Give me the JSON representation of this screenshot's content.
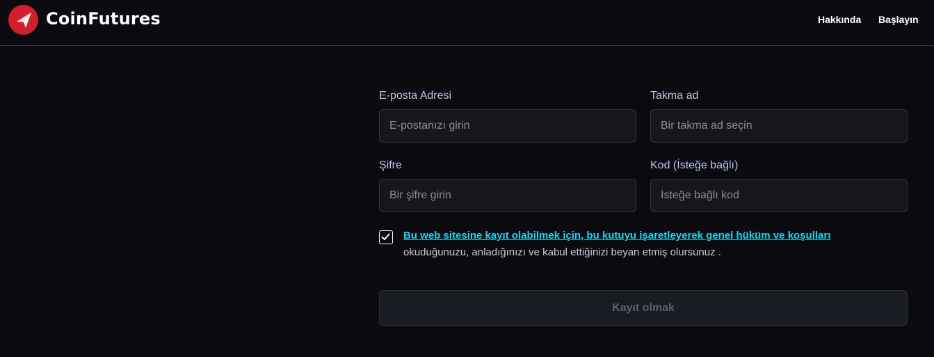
{
  "header": {
    "brand": "CoinFutures",
    "logo_icon": "coinfutures-logo",
    "logo_color": "#d21f2c",
    "nav": [
      {
        "label": "Hakkında"
      },
      {
        "label": "Başlayın"
      }
    ]
  },
  "form": {
    "email": {
      "label": "E-posta Adresi",
      "placeholder": "E-postanızı girin",
      "value": ""
    },
    "nickname": {
      "label": "Takma ad",
      "placeholder": "Bir takma ad seçin",
      "value": ""
    },
    "password": {
      "label": "Şifre",
      "placeholder": "Bir şifre girin",
      "value": ""
    },
    "code": {
      "label": "Kod (İsteğe bağlı)",
      "placeholder": "İsteğe bağlı kod",
      "value": ""
    },
    "terms": {
      "checked": true,
      "link_text": "Bu web sitesine kayıt olabilmek için, bu kutuyu işaretleyerek genel hüküm ve koşulları",
      "text": "okuduğunuzu, anladığınızı ve kabul ettiğinizi beyan etmiş olursunuz ."
    },
    "submit_label": "Kayıt olmak",
    "link_color": "#22d3ee"
  }
}
